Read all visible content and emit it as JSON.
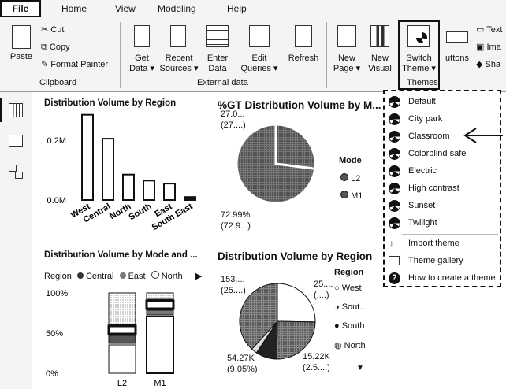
{
  "ribbon": {
    "file_label": "File",
    "tabs": [
      "Home",
      "View",
      "Modeling",
      "Help"
    ],
    "clipboard": {
      "paste": "Paste",
      "cut": "Cut",
      "copy": "Copy",
      "format_painter": "Format Painter",
      "group_label": "Clipboard"
    },
    "external_data": {
      "get_data": [
        "Get",
        "Data ▾"
      ],
      "recent_sources": [
        "Recent",
        "Sources ▾"
      ],
      "enter_data": [
        "Enter",
        "Data"
      ],
      "edit_queries": [
        "Edit",
        "Queries ▾"
      ],
      "refresh": "Refresh",
      "group_label": "External data"
    },
    "new_page": [
      "New",
      "Page ▾"
    ],
    "new_visual": [
      "New",
      "Visual"
    ],
    "switch_theme": [
      "Switch",
      "Theme ▾"
    ],
    "themes_group_label": "Themes",
    "buttons_label": "uttons",
    "text_label": "Text",
    "image_label": "Ima",
    "shapes_label": "Sha"
  },
  "themes_menu": {
    "items": [
      "Default",
      "City park",
      "Classroom",
      "Colorblind safe",
      "Electric",
      "High contrast",
      "Sunset",
      "Twilight"
    ],
    "import_theme": "Import theme",
    "theme_gallery": "Theme gallery",
    "how_to": "How to create a theme"
  },
  "visuals": {
    "bar_title": "Distribution Volume by Region",
    "pie1_title": "%GT Distribution Volume by M...",
    "pie1_labels": {
      "top": [
        "27.0...",
        "(27....)"
      ],
      "bottom": [
        "72.99%",
        "(72.9...)"
      ]
    },
    "pie1_legend": {
      "title": "Mode",
      "items": [
        "L2",
        "M1"
      ]
    },
    "stack_title": "Distribution Volume by Mode and ...",
    "stack_legend": {
      "title": "Region",
      "items": [
        "Central",
        "East",
        "North"
      ]
    },
    "pie2_title": "Distribution Volume by Region",
    "pie2_labels": {
      "tl": [
        "153....",
        "(25....)"
      ],
      "tr": [
        "25....",
        "(....)"
      ],
      "bl": [
        "54.27K",
        "(9.05%)"
      ],
      "br": [
        "15.22K",
        "(2.5....)"
      ]
    },
    "pie2_legend": {
      "title": "Region",
      "items": [
        "West",
        "Sout...",
        "South",
        "North"
      ]
    }
  },
  "chart_data": [
    {
      "type": "bar",
      "title": "Distribution Volume by Region",
      "categories": [
        "West",
        "Central",
        "North",
        "South",
        "East",
        "South East"
      ],
      "values": [
        0.285,
        0.205,
        0.085,
        0.065,
        0.055,
        0.01
      ],
      "y_unit": "M",
      "y_ticks": [
        "0.0M",
        "0.2M"
      ],
      "ylim": [
        0,
        0.3
      ]
    },
    {
      "type": "pie",
      "title": "%GT Distribution Volume by M...",
      "categories": [
        "L2",
        "M1"
      ],
      "values": [
        27.01,
        72.99
      ]
    },
    {
      "type": "bar",
      "title": "Distribution Volume by Mode and ...",
      "stacked": "100%",
      "categories": [
        "L2",
        "M1"
      ],
      "y_ticks": [
        "0%",
        "50%",
        "100%"
      ]
    },
    {
      "type": "pie",
      "title": "Distribution Volume by Region",
      "categories": [
        "West",
        "Sout...",
        "South",
        "North"
      ],
      "values": [
        25.3,
        25.0,
        9.05,
        2.5
      ]
    }
  ]
}
